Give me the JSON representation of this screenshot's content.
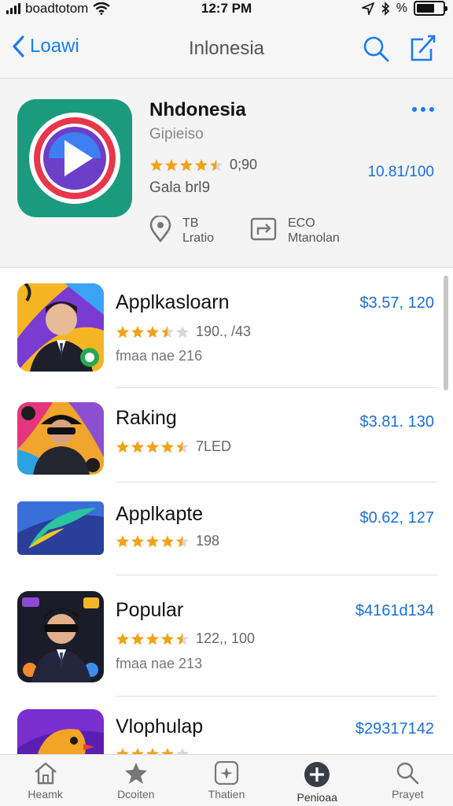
{
  "status_bar": {
    "carrier": "boadtotom",
    "time": "12:7 PM",
    "percent_glyph": "%",
    "battery_level": 0.7
  },
  "nav": {
    "back_label": "Loawi",
    "title": "Inlonesia",
    "accent_color": "#1a7bf2"
  },
  "featured": {
    "name": "Nhdonesia",
    "subtitle": "Gipieiso",
    "rating": 4.5,
    "rating_count": "0;90",
    "meta": "Gala brl9",
    "price": "10.81/100",
    "info": [
      {
        "icon": "location-pin-icon",
        "line1": "TB",
        "line2": "Lratio"
      },
      {
        "icon": "share-screen-icon",
        "line1": "ECO",
        "line2": "Mtanolan"
      }
    ]
  },
  "apps": [
    {
      "name": "Applkasloarn",
      "rating": 3.5,
      "rating_count": "190., /43",
      "meta": "fmaa nae 216",
      "price": "$3.57, 120",
      "icon": "portrait-app-icon"
    },
    {
      "name": "Raking",
      "rating": 4.5,
      "rating_count": "7LED",
      "meta": "",
      "price": "$3.81. 130",
      "icon": "sunglasses-app-icon"
    },
    {
      "name": "Applkapte",
      "rating": 4.5,
      "rating_count": "198",
      "meta": "",
      "price": "$0.62, 127",
      "icon": "swoosh-app-icon"
    },
    {
      "name": "Popular",
      "rating": 4.5,
      "rating_count": "122,, 100",
      "meta": "fmaa nae 213",
      "price": "$4161d134",
      "icon": "portrait-dark-app-icon"
    },
    {
      "name": "Vlophulap",
      "rating": 4,
      "rating_count": "",
      "meta": "",
      "price": "$29317142",
      "icon": "bird-app-icon"
    }
  ],
  "tabs": [
    {
      "label": "Heamk",
      "icon": "home-icon",
      "active": false
    },
    {
      "label": "Dcoiten",
      "icon": "star-icon",
      "active": false
    },
    {
      "label": "Thatien",
      "icon": "sparkle-icon",
      "active": false
    },
    {
      "label": "Penioaa",
      "icon": "plus-circle-icon",
      "active": true
    },
    {
      "label": "Prayet",
      "icon": "search-icon",
      "active": false
    }
  ],
  "colors": {
    "accent": "#1a7bf2",
    "price": "#1a6fd6",
    "star": "#f2a21a",
    "star_empty": "#d8d8d8"
  }
}
